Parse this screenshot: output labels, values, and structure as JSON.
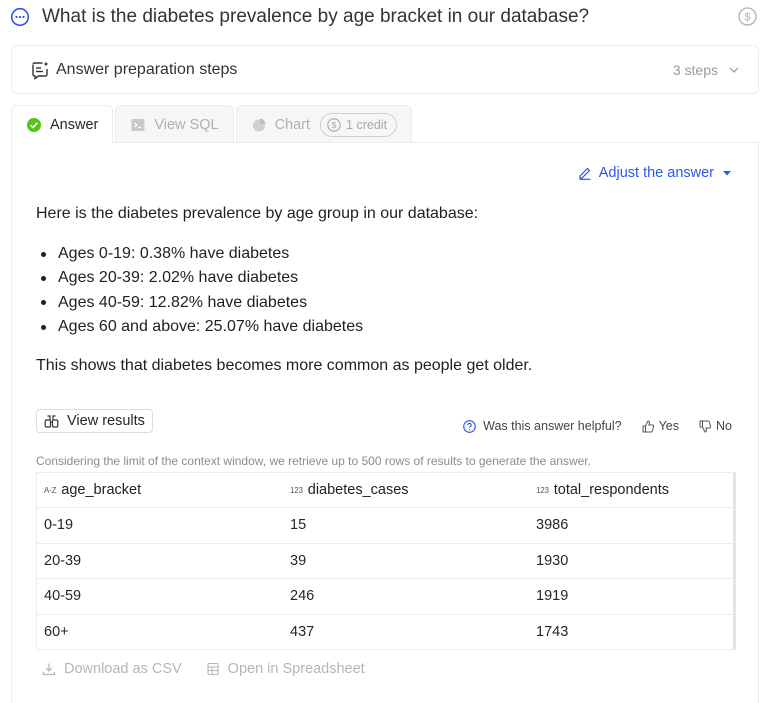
{
  "question": {
    "title": "What is the diabetes prevalence by age bracket in our database?",
    "icon": "chat-bubble-icon",
    "credit_icon": "dollar-coin-icon"
  },
  "steps": {
    "label": "Answer preparation steps",
    "count": "3 steps"
  },
  "tabs": [
    {
      "label": "Answer",
      "active": true,
      "icon": "check-circle-icon"
    },
    {
      "label": "View SQL",
      "active": false,
      "icon": "terminal-icon"
    },
    {
      "label": "Chart",
      "active": false,
      "icon": "pie-chart-icon",
      "badge": "1 credit"
    }
  ],
  "answer": {
    "adjust_label": "Adjust the answer",
    "intro": "Here is the diabetes prevalence by age group in our database:",
    "bullets": [
      "Ages 0-19: 0.38% have diabetes",
      "Ages 20-39: 2.02% have diabetes",
      "Ages 40-59: 12.82% have diabetes",
      "Ages 60 and above: 25.07% have diabetes"
    ],
    "summary": "This shows that diabetes becomes more common as people get older."
  },
  "results": {
    "view_results_label": "View results",
    "feedback_question": "Was this answer helpful?",
    "yes_label": "Yes",
    "no_label": "No",
    "context_note": "Considering the limit of the context window, we retrieve up to 500 rows of results to generate the answer.",
    "columns": [
      {
        "type": "A-Z",
        "name": "age_bracket"
      },
      {
        "type": "123",
        "name": "diabetes_cases"
      },
      {
        "type": "123",
        "name": "total_respondents"
      }
    ],
    "rows": [
      [
        "0-19",
        "15",
        "3986"
      ],
      [
        "20-39",
        "39",
        "1930"
      ],
      [
        "40-59",
        "246",
        "1919"
      ],
      [
        "60+",
        "437",
        "1743"
      ]
    ],
    "download_label": "Download as CSV",
    "spreadsheet_label": "Open in Spreadsheet"
  },
  "colors": {
    "accent": "#2f54eb",
    "success": "#52c41a",
    "muted": "#b5b5b5",
    "border": "#ececec"
  }
}
